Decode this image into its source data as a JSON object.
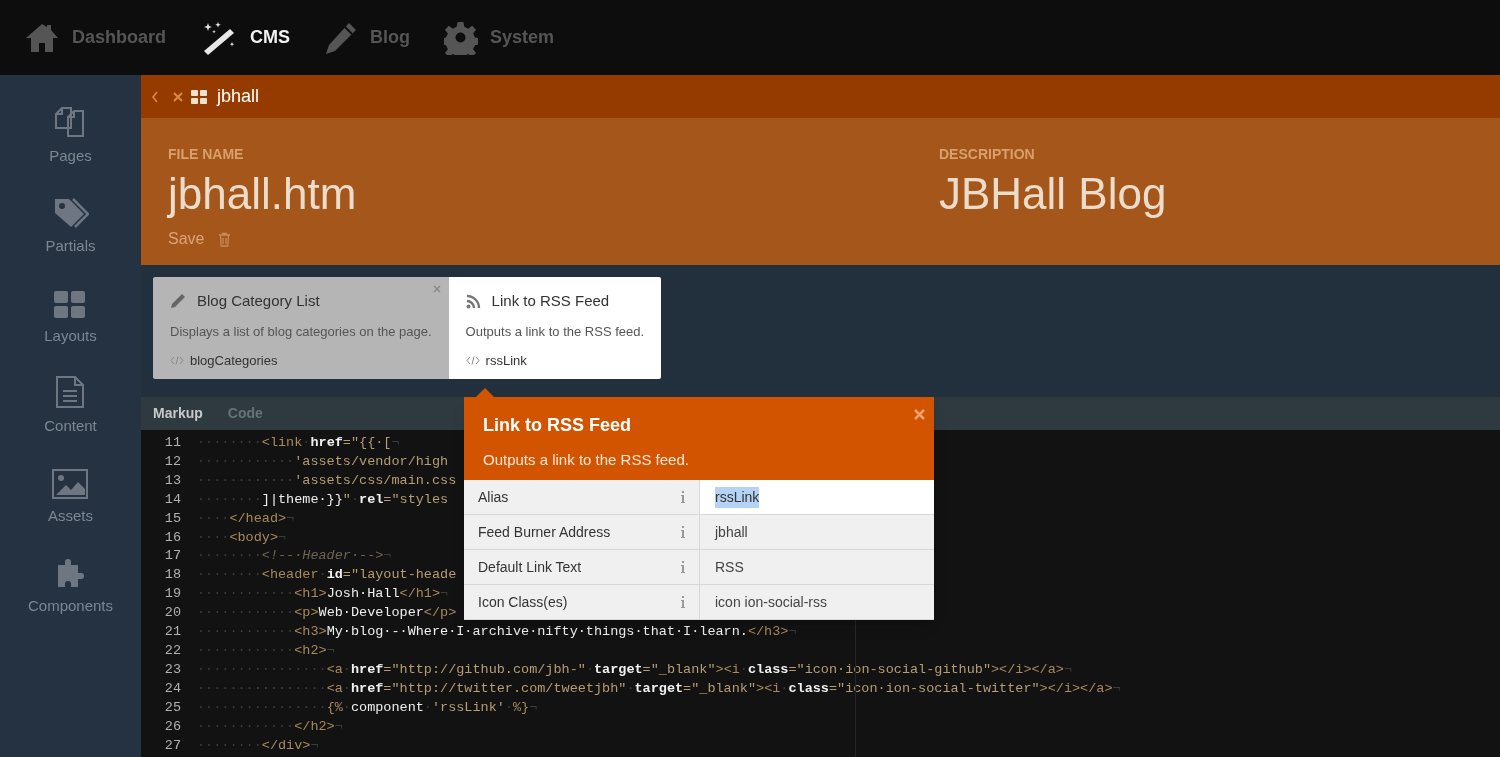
{
  "top_nav": [
    {
      "label": "Dashboard",
      "selected": false
    },
    {
      "label": "CMS",
      "selected": true
    },
    {
      "label": "Blog",
      "selected": false
    },
    {
      "label": "System",
      "selected": false
    }
  ],
  "sidebar": {
    "items": [
      {
        "label": "Pages"
      },
      {
        "label": "Partials"
      },
      {
        "label": "Layouts"
      },
      {
        "label": "Content"
      },
      {
        "label": "Assets"
      },
      {
        "label": "Components"
      }
    ]
  },
  "breadcrumb": {
    "title": "jbhall"
  },
  "header": {
    "file_name_label": "FILE NAME",
    "file_name": "jbhall.htm",
    "save": "Save",
    "description_label": "DESCRIPTION",
    "description": "JBHall Blog"
  },
  "components": [
    {
      "title": "Blog Category List",
      "description": "Displays a list of blog categories on the page.",
      "alias": "blogCategories",
      "selected": false,
      "show_close": true
    },
    {
      "title": "Link to RSS Feed",
      "description": "Outputs a link to the RSS feed.",
      "alias": "rssLink",
      "selected": true,
      "show_close": false
    }
  ],
  "editor_tabs": [
    {
      "label": "Markup",
      "selected": true
    },
    {
      "label": "Code",
      "selected": false
    }
  ],
  "code_lines": [
    {
      "number": "11",
      "tokens": [
        {
          "kind": "ws",
          "text": "········"
        },
        {
          "kind": "tag",
          "text": "<link"
        },
        {
          "kind": "ws",
          "text": "·"
        },
        {
          "kind": "attr",
          "text": "href"
        },
        {
          "kind": "str",
          "text": "=\"{{·["
        },
        {
          "kind": "eol",
          "text": "¬"
        }
      ]
    },
    {
      "number": "12",
      "tokens": [
        {
          "kind": "ws",
          "text": "············"
        },
        {
          "kind": "str",
          "text": "'assets/vendor/high"
        }
      ]
    },
    {
      "number": "13",
      "tokens": [
        {
          "kind": "ws",
          "text": "············"
        },
        {
          "kind": "str",
          "text": "'assets/css/main.css"
        }
      ]
    },
    {
      "number": "14",
      "tokens": [
        {
          "kind": "ws",
          "text": "········"
        },
        {
          "kind": "text",
          "text": "]|theme·}}"
        },
        {
          "kind": "str",
          "text": "\""
        },
        {
          "kind": "ws",
          "text": "·"
        },
        {
          "kind": "attr",
          "text": "rel"
        },
        {
          "kind": "str",
          "text": "=\"styles"
        }
      ]
    },
    {
      "number": "15",
      "tokens": [
        {
          "kind": "ws",
          "text": "····"
        },
        {
          "kind": "tag",
          "text": "</head>"
        },
        {
          "kind": "eol",
          "text": "¬"
        }
      ]
    },
    {
      "number": "16",
      "tokens": [
        {
          "kind": "ws",
          "text": "····"
        },
        {
          "kind": "tag",
          "text": "<body>"
        },
        {
          "kind": "eol",
          "text": "¬"
        }
      ]
    },
    {
      "number": "17",
      "tokens": [
        {
          "kind": "ws",
          "text": "········"
        },
        {
          "kind": "comment",
          "text": "<!--·Header·-->"
        },
        {
          "kind": "eol",
          "text": "¬"
        }
      ]
    },
    {
      "number": "18",
      "tokens": [
        {
          "kind": "ws",
          "text": "········"
        },
        {
          "kind": "tag",
          "text": "<header"
        },
        {
          "kind": "ws",
          "text": "·"
        },
        {
          "kind": "attr",
          "text": "id"
        },
        {
          "kind": "str",
          "text": "=\"layout-heade"
        }
      ]
    },
    {
      "number": "19",
      "tokens": [
        {
          "kind": "ws",
          "text": "············"
        },
        {
          "kind": "tag",
          "text": "<h1>"
        },
        {
          "kind": "text",
          "text": "Josh·Hall"
        },
        {
          "kind": "tag",
          "text": "</h1>"
        },
        {
          "kind": "eol",
          "text": "¬"
        }
      ]
    },
    {
      "number": "20",
      "tokens": [
        {
          "kind": "ws",
          "text": "············"
        },
        {
          "kind": "tag",
          "text": "<p>"
        },
        {
          "kind": "text",
          "text": "Web·Developer"
        },
        {
          "kind": "tag",
          "text": "</p>"
        }
      ]
    },
    {
      "number": "21",
      "tokens": [
        {
          "kind": "ws",
          "text": "············"
        },
        {
          "kind": "tag",
          "text": "<h3>"
        },
        {
          "kind": "text",
          "text": "My·blog·-·Where·I·archive·nifty·things·that·I·learn."
        },
        {
          "kind": "tag",
          "text": "</h3>"
        },
        {
          "kind": "eol",
          "text": "¬"
        }
      ]
    },
    {
      "number": "22",
      "tokens": [
        {
          "kind": "ws",
          "text": "············"
        },
        {
          "kind": "tag",
          "text": "<h2>"
        },
        {
          "kind": "eol",
          "text": "¬"
        }
      ]
    },
    {
      "number": "23",
      "tokens": [
        {
          "kind": "ws",
          "text": "················"
        },
        {
          "kind": "tag",
          "text": "<a"
        },
        {
          "kind": "ws",
          "text": "·"
        },
        {
          "kind": "attr",
          "text": "href"
        },
        {
          "kind": "str",
          "text": "=\"http://github.com/jbh-\""
        },
        {
          "kind": "ws",
          "text": "·"
        },
        {
          "kind": "attr",
          "text": "target"
        },
        {
          "kind": "str",
          "text": "=\"_blank\""
        },
        {
          "kind": "tag",
          "text": "><i"
        },
        {
          "kind": "ws",
          "text": "·"
        },
        {
          "kind": "attr",
          "text": "class"
        },
        {
          "kind": "str",
          "text": "=\"icon·ion-social-github\""
        },
        {
          "kind": "tag",
          "text": "></i></a>"
        },
        {
          "kind": "eol",
          "text": "¬"
        }
      ]
    },
    {
      "number": "24",
      "tokens": [
        {
          "kind": "ws",
          "text": "················"
        },
        {
          "kind": "tag",
          "text": "<a"
        },
        {
          "kind": "ws",
          "text": "·"
        },
        {
          "kind": "attr",
          "text": "href"
        },
        {
          "kind": "str",
          "text": "=\"http://twitter.com/tweetjbh\""
        },
        {
          "kind": "ws",
          "text": "·"
        },
        {
          "kind": "attr",
          "text": "target"
        },
        {
          "kind": "str",
          "text": "=\"_blank\""
        },
        {
          "kind": "tag",
          "text": "><i"
        },
        {
          "kind": "ws",
          "text": "·"
        },
        {
          "kind": "attr",
          "text": "class"
        },
        {
          "kind": "str",
          "text": "=\"icon·ion-social-twitter\""
        },
        {
          "kind": "tag",
          "text": "></i></a>"
        },
        {
          "kind": "eol",
          "text": "¬"
        }
      ]
    },
    {
      "number": "25",
      "tokens": [
        {
          "kind": "ws",
          "text": "················"
        },
        {
          "kind": "tag",
          "text": "{%"
        },
        {
          "kind": "ws",
          "text": "·"
        },
        {
          "kind": "text",
          "text": "component"
        },
        {
          "kind": "ws",
          "text": "·"
        },
        {
          "kind": "str",
          "text": "'rssLink'"
        },
        {
          "kind": "ws",
          "text": "·"
        },
        {
          "kind": "tag",
          "text": "%}"
        },
        {
          "kind": "eol",
          "text": "¬"
        }
      ]
    },
    {
      "number": "26",
      "tokens": [
        {
          "kind": "ws",
          "text": "············"
        },
        {
          "kind": "tag",
          "text": "</h2>"
        },
        {
          "kind": "eol",
          "text": "¬"
        }
      ]
    },
    {
      "number": "27",
      "tokens": [
        {
          "kind": "ws",
          "text": "········"
        },
        {
          "kind": "tag",
          "text": "</div>"
        },
        {
          "kind": "eol",
          "text": "¬"
        }
      ]
    }
  ],
  "popup": {
    "title": "Link to RSS Feed",
    "description": "Outputs a link to the RSS feed.",
    "properties": [
      {
        "label": "Alias",
        "value": "rssLink",
        "focused": true
      },
      {
        "label": "Feed Burner Address",
        "value": "jbhall",
        "focused": false
      },
      {
        "label": "Default Link Text",
        "value": "RSS",
        "focused": false
      },
      {
        "label": "Icon Class(es)",
        "value": "icon ion-social-rss",
        "focused": false
      }
    ]
  }
}
